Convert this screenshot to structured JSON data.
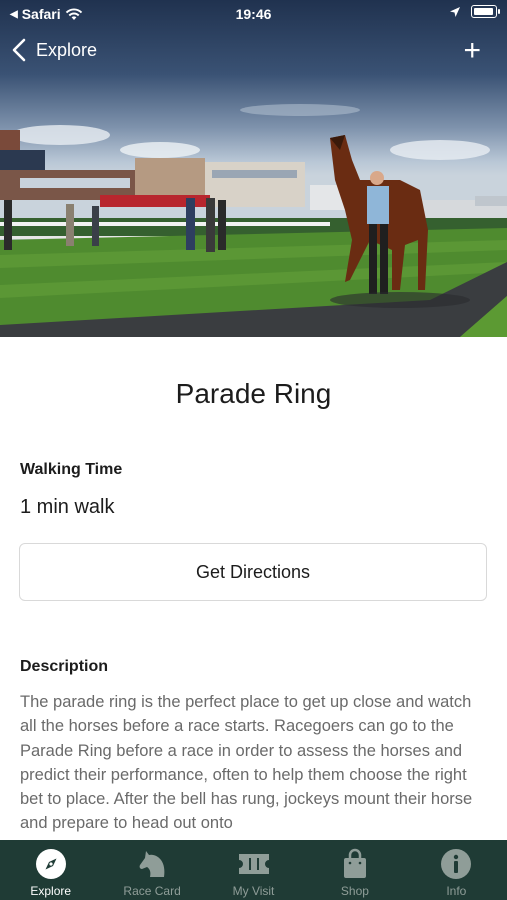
{
  "status_bar": {
    "back_app": "Safari",
    "time": "19:46"
  },
  "nav": {
    "back_label": "Explore",
    "add_symbol": "+"
  },
  "page": {
    "title": "Parade Ring",
    "walking_time_label": "Walking Time",
    "walking_time_value": "1 min walk",
    "directions_button": "Get Directions",
    "description_label": "Description",
    "description_text": "The parade ring is the perfect place to get up close and watch all the horses before a race starts. Racegoers can go to the Parade Ring before a race in order to assess the horses and predict their performance, often to help them choose the right bet to place. After the bell has rung, jockeys mount their horse and prepare to head out onto"
  },
  "tab_bar": {
    "items": [
      {
        "label": "Explore",
        "icon": "compass-icon",
        "active": true
      },
      {
        "label": "Race Card",
        "icon": "horse-head-icon",
        "active": false
      },
      {
        "label": "My Visit",
        "icon": "ticket-icon",
        "active": false
      },
      {
        "label": "Shop",
        "icon": "shopping-bag-icon",
        "active": false
      },
      {
        "label": "Info",
        "icon": "info-icon",
        "active": false
      }
    ]
  },
  "colors": {
    "tab_bar_bg": "#1f3b35",
    "tab_inactive": "#8f9d98",
    "tab_active": "#ffffff"
  }
}
